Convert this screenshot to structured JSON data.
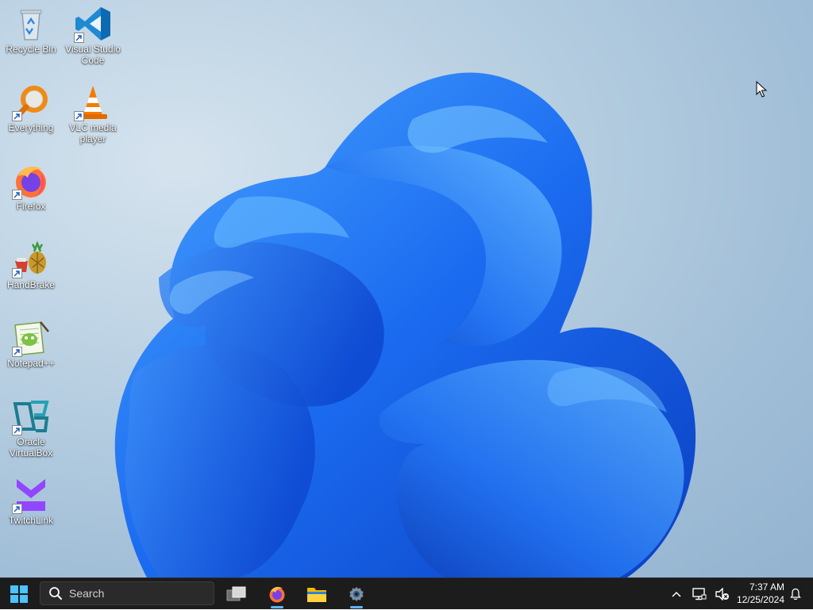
{
  "desktop": {
    "icons": [
      {
        "label": "Recycle Bin",
        "icon": "recycle-bin-icon"
      },
      {
        "label": "Visual Studio Code",
        "icon": "vscode-icon"
      },
      {
        "label": "Everything",
        "icon": "everything-search-icon"
      },
      {
        "label": "VLC media player",
        "icon": "vlc-icon"
      },
      {
        "label": "Firefox",
        "icon": "firefox-icon"
      },
      {
        "label": "HandBrake",
        "icon": "handbrake-icon"
      },
      {
        "label": "Notepad++",
        "icon": "notepadpp-icon"
      },
      {
        "label": "Oracle VirtualBox",
        "icon": "virtualbox-icon"
      },
      {
        "label": "TwitchLink",
        "icon": "twitchlink-icon"
      }
    ]
  },
  "taskbar": {
    "search_placeholder": "Search",
    "pinned": [
      {
        "name": "Task View",
        "icon": "task-view-icon",
        "running": false
      },
      {
        "name": "Firefox",
        "icon": "firefox-icon",
        "running": true
      },
      {
        "name": "File Explorer",
        "icon": "file-explorer-icon",
        "running": false
      },
      {
        "name": "Settings",
        "icon": "settings-gear-icon",
        "running": true
      }
    ],
    "tray": {
      "time": "7:37 AM",
      "date": "12/25/2024"
    }
  },
  "colors": {
    "taskbar_bg": "#1c1c1c",
    "accent": "#5fb2f2",
    "wallpaper_bloom": "#1a5fe8"
  }
}
